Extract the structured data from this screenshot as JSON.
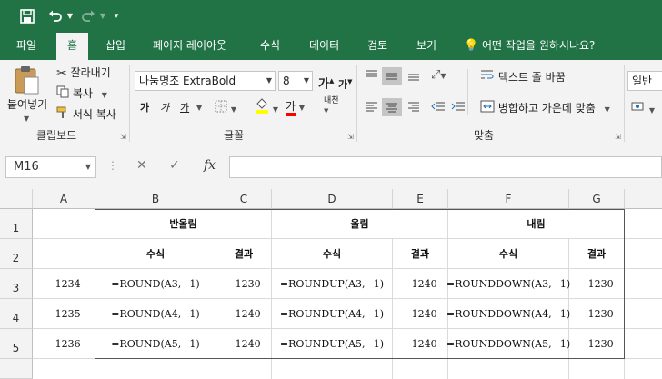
{
  "titlebar": {
    "save_icon": "floppy-disk-icon",
    "undo_icon": "undo-icon",
    "redo_icon": "redo-icon",
    "customize_icon": "customize-quick-access-icon"
  },
  "tabs": [
    "파일",
    "홈",
    "삽입",
    "페이지 레이아웃",
    "수식",
    "데이터",
    "검토",
    "보기"
  ],
  "tell_me": "어떤 작업을 원하시나요?",
  "ribbon": {
    "clipboard": {
      "paste": "붙여넣기",
      "cut": "잘라내기",
      "copy": "복사",
      "format_painter": "서식 복사",
      "label": "클립보드"
    },
    "font": {
      "font_name": "나눔명조 ExtraBold",
      "font_size": "8",
      "grow": "가",
      "shrink": "가",
      "bold": "가",
      "italic": "가",
      "underline": "가",
      "font_color_glyph": "가",
      "phonetic": "내천",
      "label": "글꼴"
    },
    "alignment": {
      "wrap_text": "텍스트 줄 바꿈",
      "merge_center": "병합하고 가운데 맞춤",
      "label": "맞춤"
    },
    "number": {
      "format": "일반"
    }
  },
  "formula_bar": {
    "name_box": "M16",
    "fx": "fx",
    "formula": ""
  },
  "columns": [
    "A",
    "B",
    "C",
    "D",
    "E",
    "F",
    "G"
  ],
  "rows": [
    "1",
    "2",
    "3",
    "4",
    "5"
  ],
  "sheet": {
    "row1": {
      "b": "반올림",
      "d": "올림",
      "f": "내림"
    },
    "row2": {
      "b": "수식",
      "c": "결과",
      "d": "수식",
      "e": "결과",
      "f": "수식",
      "g": "결과"
    },
    "data": [
      {
        "a": "−1234",
        "b": "=ROUND(A3,−1)",
        "c": "−1230",
        "d": "=ROUNDUP(A3,−1)",
        "e": "−1240",
        "f": "=ROUNDDOWN(A3,−1)",
        "g": "−1230"
      },
      {
        "a": "−1235",
        "b": "=ROUND(A4,−1)",
        "c": "−1240",
        "d": "=ROUNDUP(A4,−1)",
        "e": "−1240",
        "f": "=ROUNDDOWN(A4,−1)",
        "g": "−1230"
      },
      {
        "a": "−1236",
        "b": "=ROUND(A5,−1)",
        "c": "−1240",
        "d": "=ROUNDUP(A5,−1)",
        "e": "−1240",
        "f": "=ROUNDDOWN(A5,−1)",
        "g": "−1230"
      }
    ]
  },
  "colors": {
    "accent": "#217346",
    "ribbon_bg": "#f3f3f3"
  }
}
